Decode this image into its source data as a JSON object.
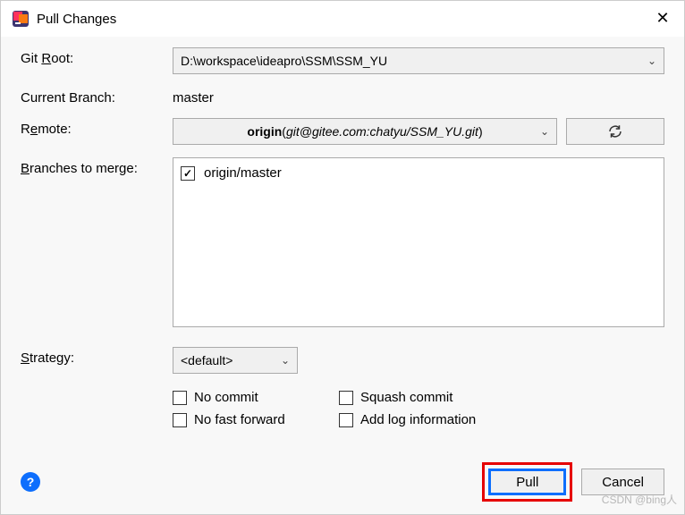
{
  "title": "Pull Changes",
  "labels": {
    "gitRoot": "Git Root:",
    "gitRootAccess": "R",
    "currentBranch": "Current Branch:",
    "remote": "Remote:",
    "remoteAccess": "e",
    "branchesToMerge": "Branches to merge:",
    "branchesAccess": "B",
    "strategy": "Strategy:",
    "strategyAccess": "S"
  },
  "gitRoot": {
    "value": "D:\\workspace\\ideapro\\SSM\\SSM_YU"
  },
  "currentBranch": "master",
  "remote": {
    "name": "origin",
    "url": "git@gitee.com:chatyu/SSM_YU.git"
  },
  "branches": [
    {
      "label": "origin/master",
      "checked": true
    }
  ],
  "strategy": {
    "value": "<default>"
  },
  "options": {
    "noCommit": {
      "label": "No commit",
      "access": "o",
      "checked": false
    },
    "squash": {
      "label": "Squash commit",
      "access": "S",
      "checked": false
    },
    "noFastForward": {
      "label": "No fast forward",
      "access": "f",
      "checked": false
    },
    "addLog": {
      "label": "Add log information",
      "access": "l",
      "checked": false
    }
  },
  "buttons": {
    "pull": "Pull",
    "cancel": "Cancel"
  },
  "watermark": "CSDN @bing人"
}
